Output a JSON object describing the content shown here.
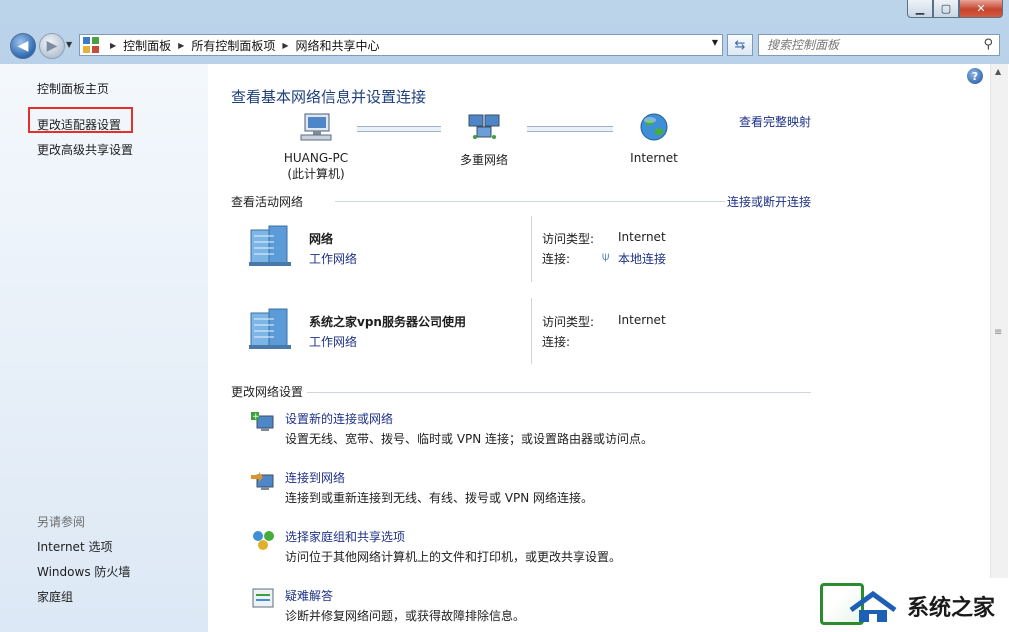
{
  "window": {
    "min_icon": "minimize-icon",
    "max_icon": "maximize-icon",
    "close_icon": "close-icon"
  },
  "nav": {
    "breadcrumbs": [
      "控制面板",
      "所有控制面板项",
      "网络和共享中心"
    ],
    "search_placeholder": "搜索控制面板"
  },
  "sidebar": {
    "items": [
      {
        "label": "控制面板主页"
      },
      {
        "label": "更改适配器设置"
      },
      {
        "label": "更改高级共享设置"
      }
    ],
    "see_also_label": "另请参阅",
    "see_also": [
      {
        "label": "Internet 选项"
      },
      {
        "label": "Windows 防火墙"
      },
      {
        "label": "家庭组"
      }
    ]
  },
  "main": {
    "title": "查看基本网络信息并设置连接",
    "full_map_link": "查看完整映射",
    "map": {
      "computer_name": "HUANG-PC",
      "computer_sub": "(此计算机)",
      "middle": "多重网络",
      "internet": "Internet"
    },
    "active_section": "查看活动网络",
    "connect_link": "连接或断开连接",
    "networks": [
      {
        "name": "网络",
        "type": "工作网络",
        "access_label": "访问类型:",
        "access_value": "Internet",
        "conn_label": "连接:",
        "conn_value": "本地连接"
      },
      {
        "name": "系统之家vpn服务器公司使用",
        "type": "工作网络",
        "access_label": "访问类型:",
        "access_value": "Internet",
        "conn_label": "连接:",
        "conn_value": ""
      }
    ],
    "change_section": "更改网络设置",
    "tasks": [
      {
        "title": "设置新的连接或网络",
        "desc": "设置无线、宽带、拨号、临时或 VPN 连接；或设置路由器或访问点。"
      },
      {
        "title": "连接到网络",
        "desc": "连接到或重新连接到无线、有线、拨号或 VPN 网络连接。"
      },
      {
        "title": "选择家庭组和共享选项",
        "desc": "访问位于其他网络计算机上的文件和打印机，或更改共享设置。"
      },
      {
        "title": "疑难解答",
        "desc": "诊断并修复网络问题，或获得故障排除信息。"
      }
    ]
  },
  "watermark": {
    "text": "系统之家"
  }
}
